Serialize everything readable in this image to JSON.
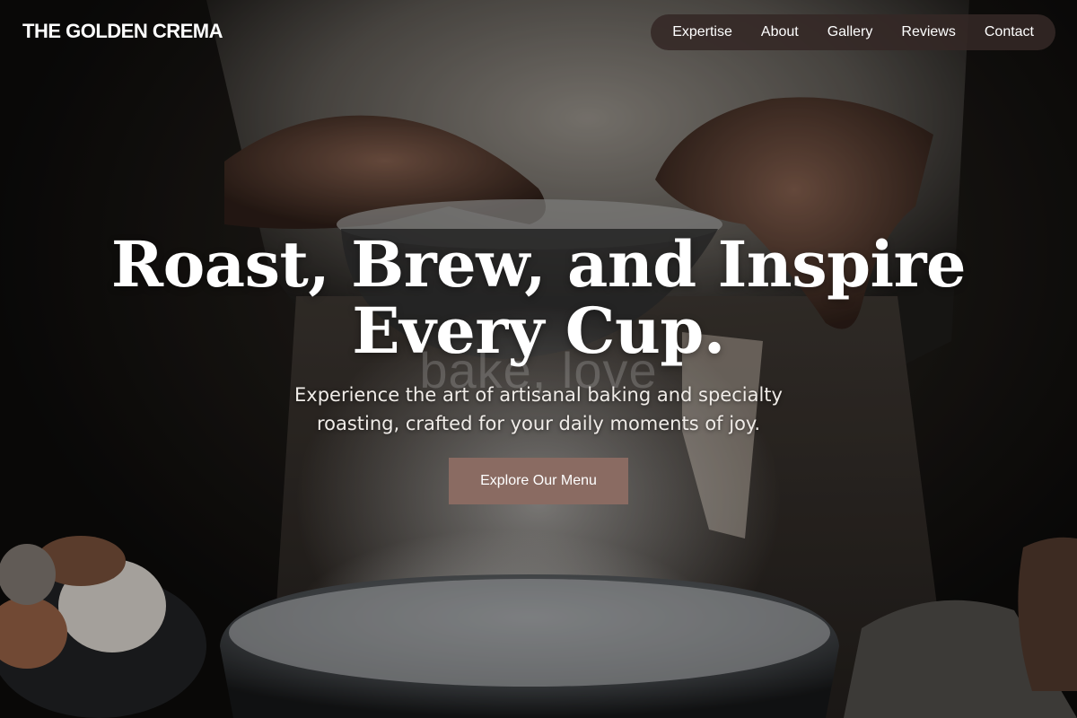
{
  "header": {
    "brand": "THE GOLDEN CREMA",
    "nav": [
      "Expertise",
      "About",
      "Gallery",
      "Reviews",
      "Contact"
    ]
  },
  "hero": {
    "title": "Roast, Brew, and Inspire Every Cup.",
    "ghost_text": "bake, love",
    "subtitle": "Experience the art of artisanal baking and specialty roasting, crafted for your daily moments of joy.",
    "cta_label": "Explore Our Menu"
  },
  "colors": {
    "nav_pill": "#342826",
    "cta_button": "#8a6b62",
    "background": "#0d0b0a"
  }
}
